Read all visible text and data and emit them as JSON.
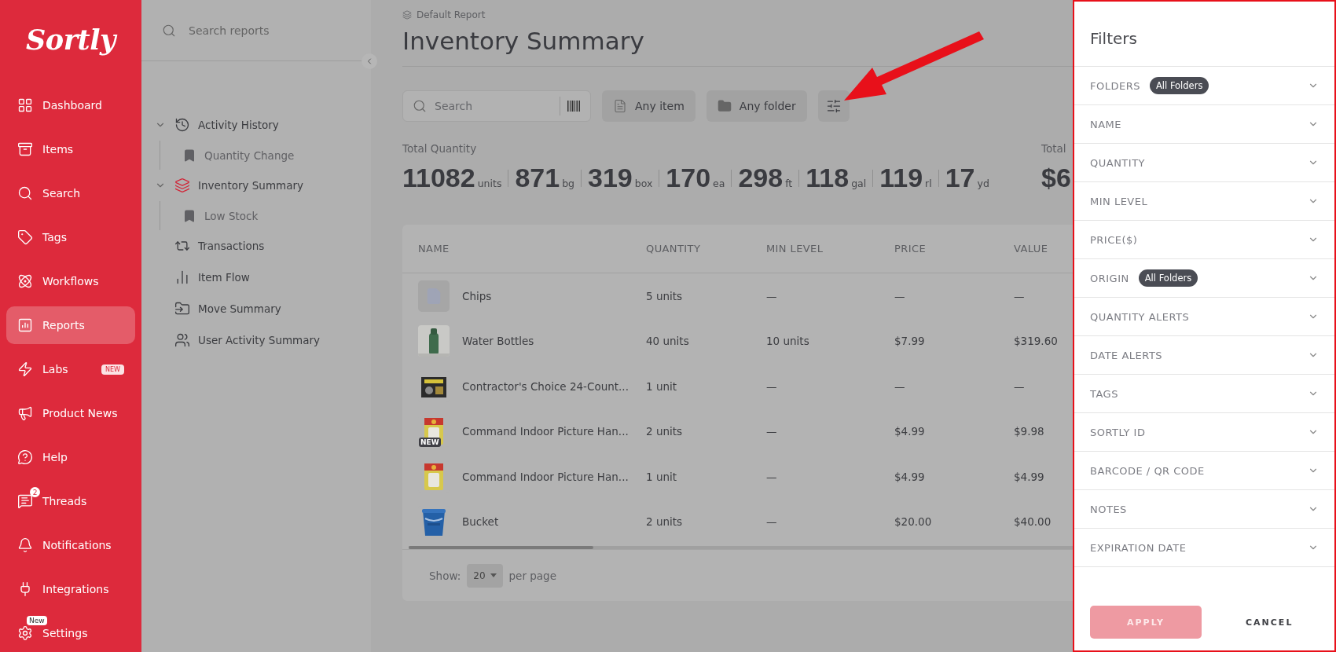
{
  "sidebar": {
    "logo": "Sortly",
    "items": [
      {
        "label": "Dashboard",
        "selected": false
      },
      {
        "label": "Items",
        "selected": false
      },
      {
        "label": "Search",
        "selected": false
      },
      {
        "label": "Tags",
        "selected": false
      },
      {
        "label": "Workflows",
        "selected": false
      },
      {
        "label": "Reports",
        "selected": true
      },
      {
        "label": "Labs",
        "selected": false,
        "badge": {
          "kind": "pill",
          "text": "NEW"
        }
      },
      {
        "label": "Product News",
        "selected": false
      },
      {
        "label": "Help",
        "selected": false
      },
      {
        "label": "Threads",
        "selected": false,
        "badge": {
          "kind": "count",
          "text": "2"
        }
      },
      {
        "label": "Notifications",
        "selected": false
      },
      {
        "label": "Integrations",
        "selected": false
      },
      {
        "label": "Settings",
        "selected": false,
        "badge": {
          "kind": "tag",
          "text": "New"
        }
      }
    ]
  },
  "reports_panel": {
    "search": {
      "placeholder": "Search reports"
    },
    "tree": [
      {
        "label": "Activity History",
        "selected": false,
        "expanded": true,
        "children": [
          {
            "label": "Quantity Change"
          }
        ]
      },
      {
        "label": "Inventory Summary",
        "selected": true,
        "expanded": true,
        "children": [
          {
            "label": "Low Stock"
          }
        ]
      },
      {
        "label": "Transactions",
        "selected": false
      },
      {
        "label": "Item Flow",
        "selected": false
      },
      {
        "label": "Move Summary",
        "selected": false
      },
      {
        "label": "User Activity Summary",
        "selected": false
      }
    ]
  },
  "report": {
    "breadcrumb": "Default Report",
    "title": "Inventory Summary",
    "toolbar": {
      "search": {
        "placeholder": "Search"
      },
      "item_filter": "Any item",
      "folder_filter": "Any folder"
    },
    "total_quantity": {
      "label": "Total Quantity",
      "values": [
        {
          "value": "11082",
          "unit": "units"
        },
        {
          "value": "871",
          "unit": "bg"
        },
        {
          "value": "319",
          "unit": "box"
        },
        {
          "value": "170",
          "unit": "ea"
        },
        {
          "value": "298",
          "unit": "ft"
        },
        {
          "value": "118",
          "unit": "gal"
        },
        {
          "value": "119",
          "unit": "rl"
        },
        {
          "value": "17",
          "unit": "yd"
        }
      ]
    },
    "total_value": {
      "label": "Total",
      "value": "$6"
    },
    "table": {
      "columns": [
        "NAME",
        "QUANTITY",
        "MIN LEVEL",
        "PRICE",
        "VALUE"
      ],
      "rows": [
        {
          "thumbnail": {
            "kind": "file"
          },
          "name": "Chips",
          "quantity": "5 units",
          "min_level": "—",
          "price": "—",
          "value": "—"
        },
        {
          "name": "Water Bottles",
          "quantity": "40 units",
          "min_level": "10 units",
          "price": "$7.99",
          "value": "$319.60"
        },
        {
          "name": "Contractor's Choice 24-Count...",
          "quantity": "1 unit",
          "min_level": "—",
          "price": "—",
          "value": "—"
        },
        {
          "thumbnail": {
            "kind": "picture",
            "badge": "NEW"
          },
          "name": "Command Indoor Picture Han...",
          "quantity": "2 units",
          "min_level": "—",
          "price": "$4.99",
          "value": "$9.98"
        },
        {
          "name": "Command Indoor Picture Han...",
          "quantity": "1 unit",
          "min_level": "—",
          "price": "$4.99",
          "value": "$4.99"
        },
        {
          "name": "Bucket",
          "quantity": "2 units",
          "min_level": "—",
          "price": "$20.00",
          "value": "$40.00"
        }
      ],
      "footer": {
        "show_label": "Show:",
        "page_size": "20",
        "per_page_label": "per page"
      }
    }
  },
  "filters": {
    "title": "Filters",
    "rows": [
      {
        "label": "FOLDERS",
        "chip": "All Folders"
      },
      {
        "label": "NAME"
      },
      {
        "label": "QUANTITY"
      },
      {
        "label": "MIN LEVEL"
      },
      {
        "label": "PRICE($)"
      },
      {
        "label": "ORIGIN",
        "chip": "All Folders"
      },
      {
        "label": "QUANTITY ALERTS"
      },
      {
        "label": "DATE ALERTS"
      },
      {
        "label": "TAGS"
      },
      {
        "label": "SORTLY ID"
      },
      {
        "label": "BARCODE / QR CODE"
      },
      {
        "label": "NOTES"
      },
      {
        "label": "EXPIRATION DATE"
      }
    ],
    "apply": {
      "label": "APPLY",
      "disabled": true
    },
    "cancel": {
      "label": "CANCEL"
    }
  }
}
